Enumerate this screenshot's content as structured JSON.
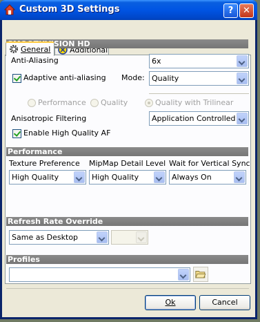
{
  "window": {
    "title": "Custom 3D Settings",
    "help_label": "?",
    "close_label": "✕"
  },
  "tabs": [
    {
      "label": "General",
      "icon": "gear-icon"
    },
    {
      "label": "Additional",
      "icon": "ati-icon"
    }
  ],
  "smoothvision": {
    "header": "SMOOTHVISION HD",
    "anti_aliasing": {
      "label": "Anti-Aliasing",
      "value": "6x"
    },
    "adaptive": {
      "label": "Adaptive anti-aliasing",
      "checked": true
    },
    "mode": {
      "label": "Mode:",
      "value": "Quality"
    },
    "radios": [
      {
        "label": "Performance",
        "selected": false
      },
      {
        "label": "Quality",
        "selected": false
      },
      {
        "label": "Quality with Trilinear",
        "selected": true
      }
    ],
    "anisotropic": {
      "label": "Anisotropic Filtering",
      "value": "Application Controlled"
    },
    "high_quality_af": {
      "label": "Enable High Quality AF",
      "checked": true
    }
  },
  "performance": {
    "header": "Performance",
    "texture": {
      "label": "Texture Preference",
      "value": "High Quality"
    },
    "mipmap": {
      "label": "MipMap Detail Level",
      "value": "High Quality"
    },
    "vsync": {
      "label": "Wait for Vertical Sync",
      "value": "Always On"
    }
  },
  "refresh": {
    "header": "Refresh Rate Override",
    "value": "Same as Desktop",
    "secondary_value": ""
  },
  "profiles": {
    "header": "Profiles",
    "value": ""
  },
  "buttons": {
    "ok": "Ok",
    "cancel": "Cancel"
  },
  "colors": {
    "titlebar": "#0054e3",
    "section_header": "#808080",
    "accent_tab": "#ffc83c"
  }
}
